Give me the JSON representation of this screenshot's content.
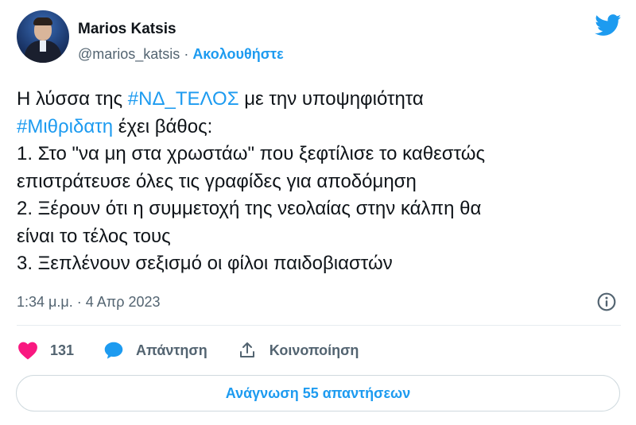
{
  "author": {
    "name": "Marios Katsis",
    "handle": "@marios_katsis",
    "separator": " · ",
    "follow_label": "Ακολουθήστε"
  },
  "tweet": {
    "lines": [
      [
        {
          "text": "Η λύσσα της "
        },
        {
          "text": "#ΝΔ_ΤΕΛΟΣ",
          "hashtag": true
        },
        {
          "text": " με την υποψηφιότητα"
        }
      ],
      [
        {
          "text": "#Μιθριδατη",
          "hashtag": true
        },
        {
          "text": " έχει βάθος:"
        }
      ],
      [
        {
          "text": "1. Στο \"να μη στα χρωστάω\" που ξεφτίλισε το καθεστώς"
        }
      ],
      [
        {
          "text": "επιστράτευσε όλες τις γραφίδες για αποδόμηση"
        }
      ],
      [
        {
          "text": "2. Ξέρουν ότι η συμμετοχή της νεολαίας στην κάλπη θα"
        }
      ],
      [
        {
          "text": "είναι το τέλος τους"
        }
      ],
      [
        {
          "text": "3. Ξεπλένουν σεξισμό οι φίλοι παιδοβιαστών"
        }
      ]
    ],
    "timestamp": "1:34 μ.μ. · 4 Απρ 2023"
  },
  "actions": {
    "like_count": "131",
    "reply_label": "Απάντηση",
    "share_label": "Κοινοποίηση"
  },
  "read_replies_label": "Ανάγνωση 55 απαντήσεων",
  "icons": {
    "logo": "twitter-bird-icon",
    "info": "info-icon",
    "like": "heart-icon",
    "reply": "speech-bubble-icon",
    "share": "share-icon"
  },
  "colors": {
    "accent": "#1d9bf0",
    "like": "#f91880",
    "secondary_text": "#536471",
    "primary_text": "#0f1419"
  }
}
